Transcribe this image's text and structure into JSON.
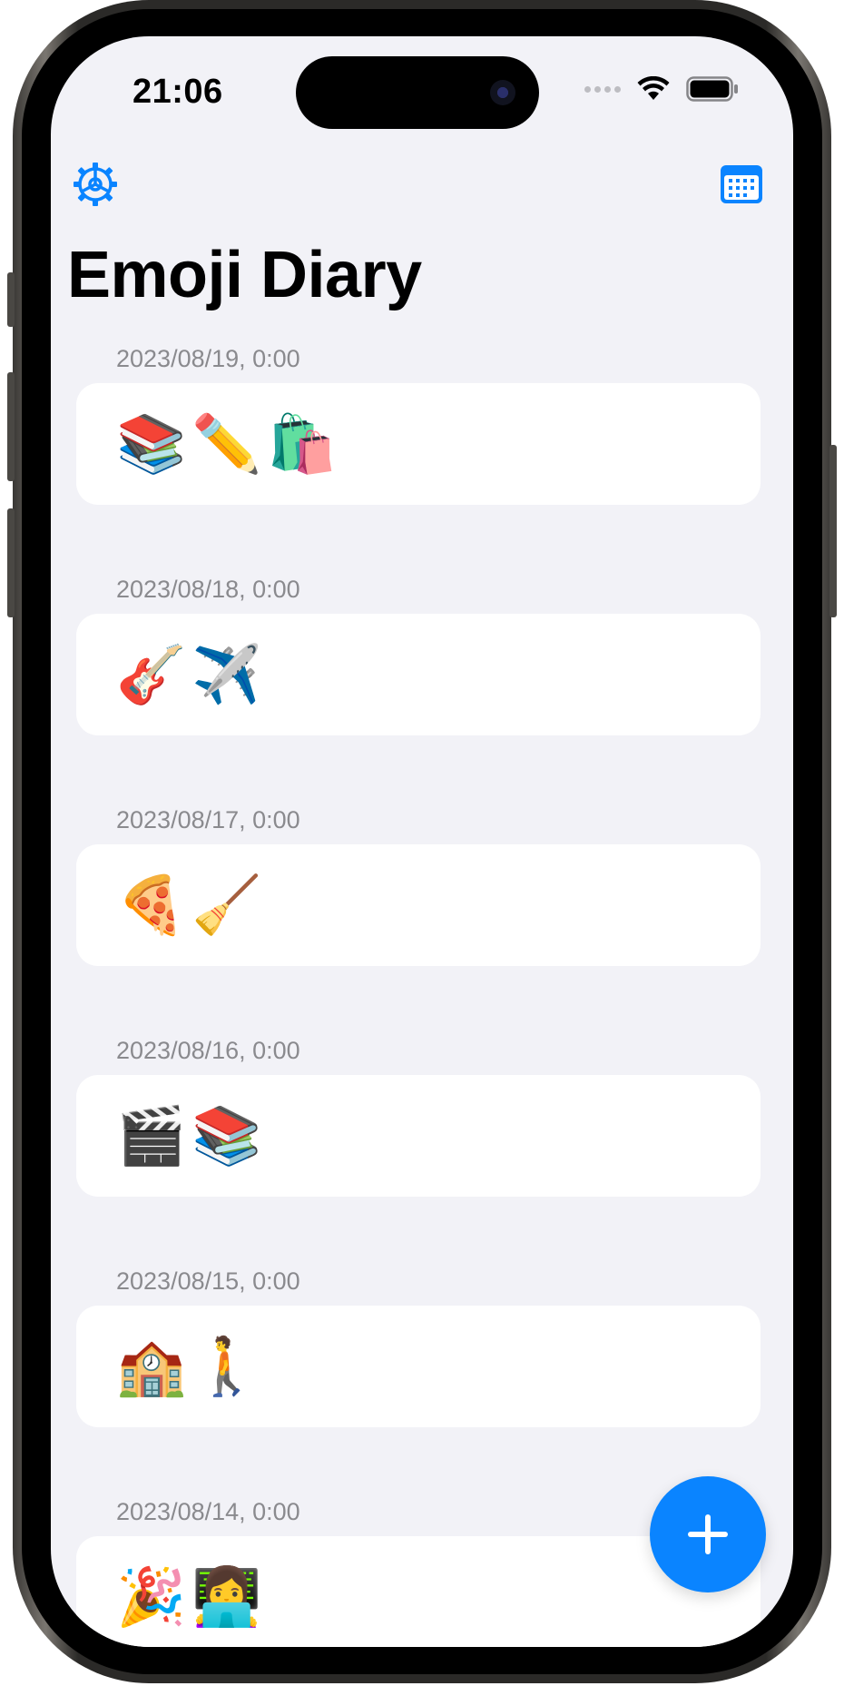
{
  "status_bar": {
    "time": "21:06",
    "icons": [
      "signal-dots-icon",
      "wifi-icon",
      "battery-icon"
    ]
  },
  "toolbar": {
    "left_icon": "gear-icon",
    "right_icon": "calendar-icon"
  },
  "page": {
    "title": "Emoji Diary"
  },
  "entries": [
    {
      "date": "2023/08/19, 0:00",
      "emojis": "📚✏️🛍️"
    },
    {
      "date": "2023/08/18, 0:00",
      "emojis": "🎸✈️"
    },
    {
      "date": "2023/08/17, 0:00",
      "emojis": "🍕🧹"
    },
    {
      "date": "2023/08/16, 0:00",
      "emojis": "🎬📚"
    },
    {
      "date": "2023/08/15, 0:00",
      "emojis": "🏫🚶"
    },
    {
      "date": "2023/08/14, 0:00",
      "emojis": "🎉👩‍💻"
    }
  ],
  "fab": {
    "icon": "plus-icon"
  },
  "colors": {
    "accent": "#0a84ff",
    "background": "#f2f2f7",
    "card": "#ffffff",
    "date_text": "#8a8a8e"
  }
}
